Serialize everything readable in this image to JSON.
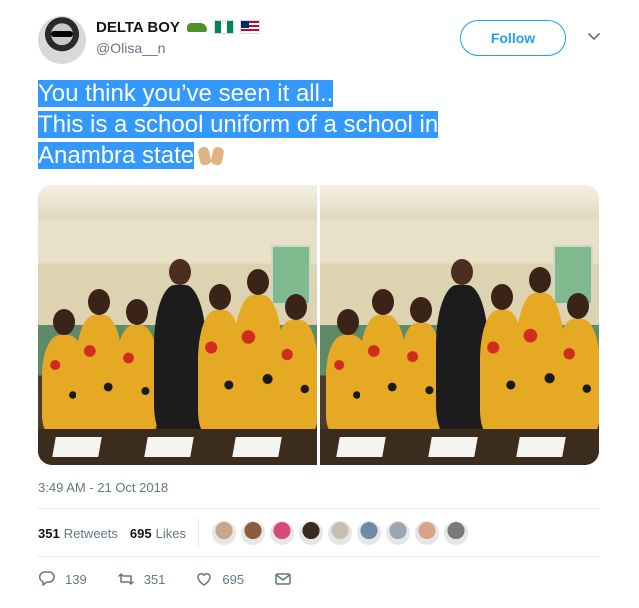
{
  "user": {
    "display_name": "DELTA BOY",
    "handle": "@Olisa__n",
    "name_icons": [
      "crocodile-icon",
      "nigeria-flag-icon",
      "liberia-flag-icon"
    ]
  },
  "follow": {
    "label": "Follow"
  },
  "tweet": {
    "lines": [
      "You think you’ve seen it all..",
      "This is a school uniform of a school in",
      "Anambra state"
    ],
    "trailing_icon": "raised-hands-icon",
    "highlight_color": "#3399ff"
  },
  "media": {
    "count": 2
  },
  "timestamp": "3:49 AM - 21 Oct 2018",
  "stats": {
    "retweets_count": "351",
    "retweets_label": "Retweets",
    "likes_count": "695",
    "likes_label": "Likes",
    "likers": [
      "#c9a58a",
      "#8c5a3c",
      "#d64a7a",
      "#3b2a22",
      "#c7c0b0",
      "#6f8aa8",
      "#9aa6b2",
      "#d9a38a",
      "#7a7a7a"
    ]
  },
  "actions": {
    "reply_count": "139",
    "retweet_count": "351",
    "like_count": "695"
  },
  "colors": {
    "accent": "#1da1f2",
    "muted": "#657786",
    "text": "#14171a"
  }
}
